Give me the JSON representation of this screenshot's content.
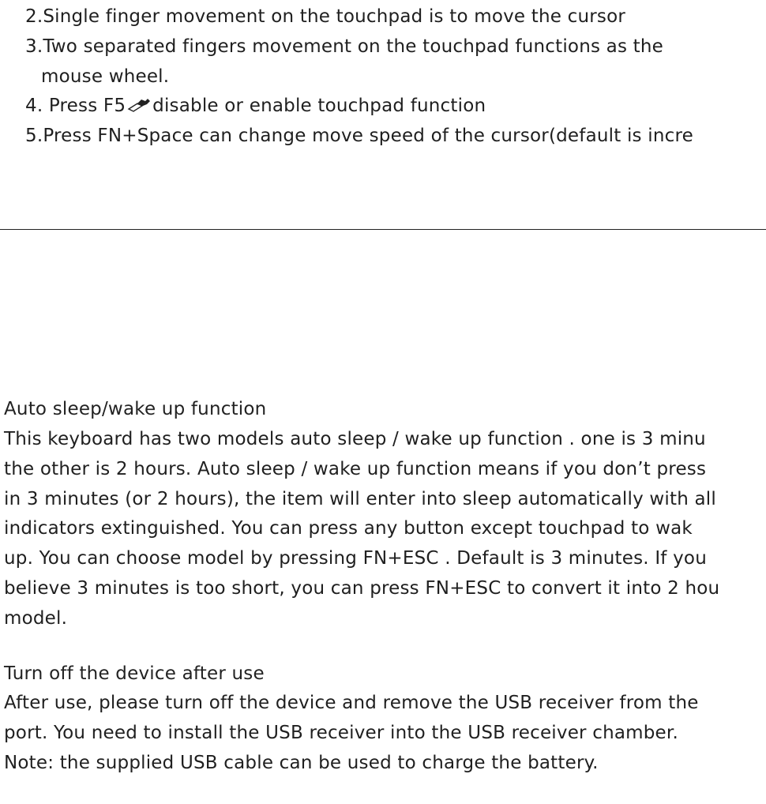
{
  "touchpad_list": {
    "item2": "2.Single finger movement on the touchpad is to move the cursor",
    "item3_line1": "3.Two separated fingers movement on the touchpad functions as the",
    "item3_line2": "mouse wheel.",
    "item4_prefix": "4. Press  F5",
    "item4_suffix": "disable or enable touchpad function",
    "item4_icon": "touchpad-icon",
    "item5": "5.Press FN+Space can change move speed of the cursor(default is incre"
  },
  "auto_sleep": {
    "heading": "Auto sleep/wake up function",
    "lines": [
      " This keyboard has two models auto sleep / wake up function . one is 3 minu",
      "the other is 2 hours. Auto sleep / wake up function means if you don’t press",
      "in 3 minutes (or 2 hours), the item will enter into sleep automatically with all",
      "indicators extinguished. You can press any button except touchpad to wak",
      "up. You can choose model by pressing FN+ESC . Default is 3 minutes. If you",
      "believe 3 minutes is too short, you can press FN+ESC to convert it into 2 hou",
      "model."
    ]
  },
  "turn_off": {
    "heading": "Turn off the device after use",
    "lines": [
      "After use, please turn off the device and remove the USB receiver from the",
      "port. You need to install the USB receiver into the USB receiver chamber.",
      "Note: the supplied USB cable can be used to charge the battery."
    ]
  }
}
